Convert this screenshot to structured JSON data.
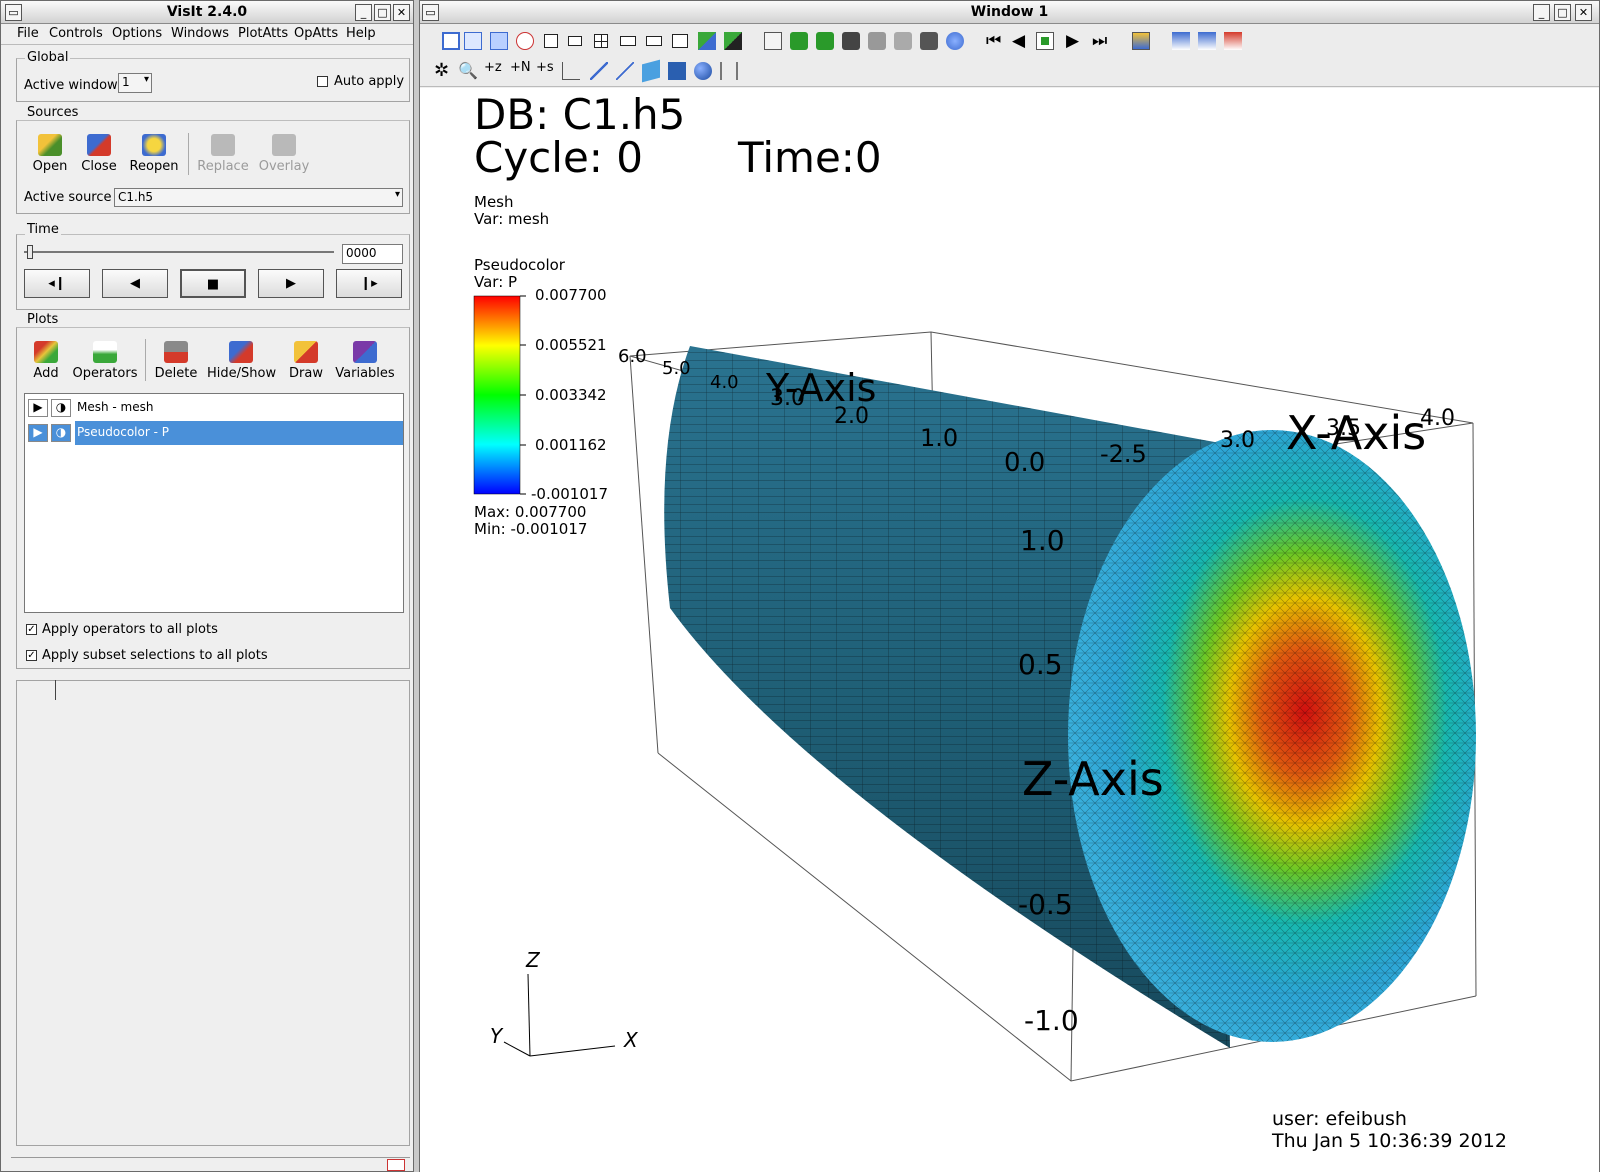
{
  "control_window": {
    "title": "VisIt 2.4.0",
    "menu": [
      "File",
      "Controls",
      "Options",
      "Windows",
      "PlotAtts",
      "OpAtts",
      "Help"
    ],
    "global": {
      "label": "Global",
      "active_window_label": "Active window",
      "active_window_value": "1",
      "auto_apply_label": "Auto apply"
    },
    "sources": {
      "label": "Sources",
      "buttons": [
        "Open",
        "Close",
        "Reopen",
        "Replace",
        "Overlay"
      ],
      "active_source_label": "Active source",
      "active_source_value": "C1.h5"
    },
    "time": {
      "label": "Time",
      "value": "0000"
    },
    "plots": {
      "label": "Plots",
      "buttons": [
        "Add",
        "Operators",
        "Delete",
        "Hide/Show",
        "Draw",
        "Variables"
      ],
      "list": [
        "Mesh - mesh",
        "Pseudocolor - P"
      ],
      "apply_operators": "Apply operators to all plots",
      "apply_subset": "Apply subset selections to all plots"
    }
  },
  "viz_window": {
    "title": "Window 1",
    "db_label": "DB: C1.h5",
    "cycle_label": "Cycle: 0",
    "time_label": "Time:0",
    "mesh_legend": {
      "title": "Mesh",
      "var": "Var: mesh"
    },
    "pc_legend": {
      "title": "Pseudocolor",
      "var": "Var: P",
      "ticks": [
        "0.007700",
        "0.005521",
        "0.003342",
        "0.001162",
        "-0.001017"
      ],
      "max": "Max:  0.007700",
      "min": "Min: -0.001017"
    },
    "axes": {
      "x_title": "X-Axis",
      "y_title": "Y-Axis",
      "z_title": "Z-Axis",
      "y_ticks": [
        "6.0",
        "5.0",
        "4.0",
        "3.0",
        "2.0",
        "1.0",
        "0.0"
      ],
      "x_ticks": [
        "-2.5",
        "3.0",
        "3.5",
        "4.0"
      ],
      "z_ticks": [
        "1.0",
        "0.5",
        "-0.5",
        "-1.0"
      ]
    },
    "triad": {
      "z": "Z",
      "y": "Y",
      "x": "X"
    },
    "user_line": "user: efeibush",
    "date_line": "Thu Jan  5 10:36:39 2012"
  },
  "colors": {
    "selection": "#4a90d9",
    "mesh_body": "#1f5f76"
  }
}
